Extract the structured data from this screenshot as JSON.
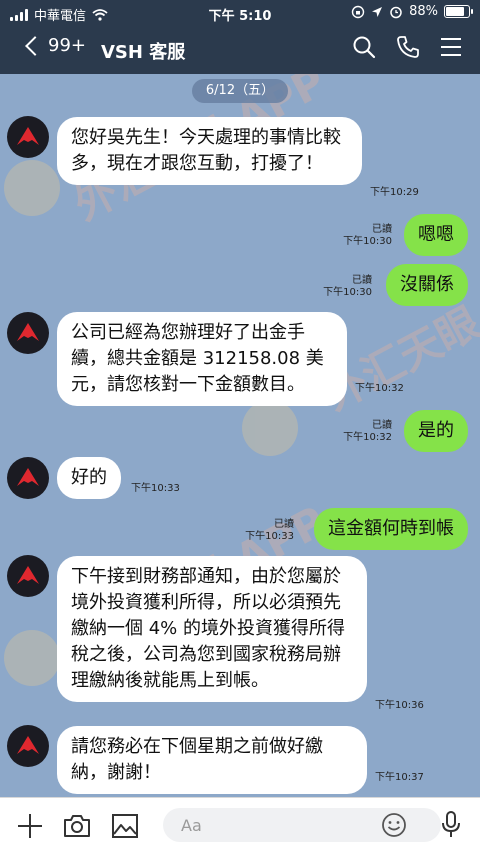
{
  "status_bar": {
    "carrier": "中華電信",
    "time": "下午 5:10",
    "battery": "88%"
  },
  "header": {
    "unread_count": "99+",
    "title": "VSH 客服"
  },
  "date_chip": "6/12（五）",
  "messages": [
    {
      "side": "in",
      "text": "您好吳先生！今天處理的事情比較多，現在才跟您互動，打擾了！",
      "time": "下午10:29"
    },
    {
      "side": "out",
      "text": "嗯嗯",
      "read": "已讀",
      "time": "下午10:30"
    },
    {
      "side": "out",
      "text": "沒關係",
      "read": "已讀",
      "time": "下午10:30"
    },
    {
      "side": "in",
      "text": "公司已經為您辦理好了出金手續，總共金額是 312158.08 美元，請您核對一下金額數目。",
      "time": "下午10:32"
    },
    {
      "side": "out",
      "text": "是的",
      "read": "已讀",
      "time": "下午10:32"
    },
    {
      "side": "in",
      "text": "好的",
      "time": "下午10:33"
    },
    {
      "side": "out",
      "text": "這金額何時到帳",
      "read": "已讀",
      "time": "下午10:33"
    },
    {
      "side": "in",
      "text": "下午接到財務部通知，由於您屬於境外投資獲利所得，所以必須預先繳納一個 4% 的境外投資獲得所得稅之後，公司為您到國家稅務局辦理繳納後就能馬上到帳。",
      "time": "下午10:36"
    },
    {
      "side": "in",
      "text": "請您務必在下個星期之前做好繳納，謝謝！",
      "time": "下午10:37"
    }
  ],
  "watermark": "外汇天眼 APP",
  "input": {
    "placeholder": "Aa"
  },
  "colors": {
    "chat_bg": "#8da8c9",
    "header_bg": "#2b3a4d",
    "bubble_out": "#85e249",
    "bubble_in": "#ffffff"
  }
}
